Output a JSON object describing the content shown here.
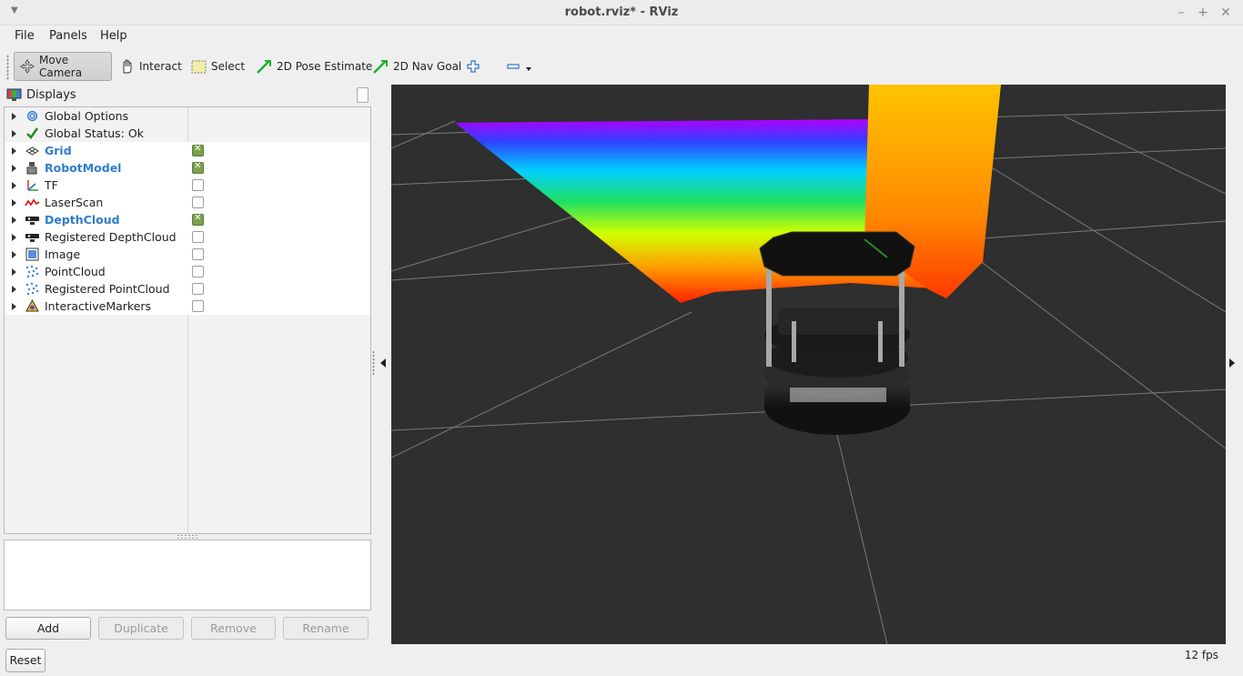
{
  "window": {
    "title": "robot.rviz* - RViz"
  },
  "menu": [
    "File",
    "Panels",
    "Help"
  ],
  "toolbar": {
    "move_camera": "Move Camera",
    "interact": "Interact",
    "select": "Select",
    "pose_estimate": "2D Pose Estimate",
    "nav_goal": "2D Nav Goal"
  },
  "displays": {
    "title": "Displays",
    "items": [
      {
        "label": "Global Options",
        "icon": "gear-icon",
        "enabled": null,
        "bold": false
      },
      {
        "label": "Global Status: Ok",
        "icon": "checkmark-icon",
        "enabled": null,
        "bold": false
      },
      {
        "label": "Grid",
        "icon": "grid-icon",
        "enabled": true,
        "bold": true
      },
      {
        "label": "RobotModel",
        "icon": "robot-model-icon",
        "enabled": true,
        "bold": true
      },
      {
        "label": "TF",
        "icon": "tf-axes-icon",
        "enabled": false,
        "bold": false
      },
      {
        "label": "LaserScan",
        "icon": "laser-scan-icon",
        "enabled": false,
        "bold": false
      },
      {
        "label": "DepthCloud",
        "icon": "depth-camera-icon",
        "enabled": true,
        "bold": true
      },
      {
        "label": "Registered DepthCloud",
        "icon": "depth-camera-icon",
        "enabled": false,
        "bold": false
      },
      {
        "label": "Image",
        "icon": "image-icon",
        "enabled": false,
        "bold": false
      },
      {
        "label": "PointCloud",
        "icon": "point-cloud-icon",
        "enabled": false,
        "bold": false
      },
      {
        "label": "Registered PointCloud",
        "icon": "point-cloud-icon",
        "enabled": false,
        "bold": false
      },
      {
        "label": "InteractiveMarkers",
        "icon": "interactive-markers-icon",
        "enabled": false,
        "bold": false
      }
    ]
  },
  "buttons": {
    "add": "Add",
    "duplicate": "Duplicate",
    "remove": "Remove",
    "rename": "Rename"
  },
  "status": {
    "reset": "Reset",
    "fps": "12 fps"
  },
  "colors": {
    "enabled_blue": "#2f7cc9",
    "checkbox_green": "#7ba14e",
    "viewport_bg": "#2f2f2f"
  }
}
